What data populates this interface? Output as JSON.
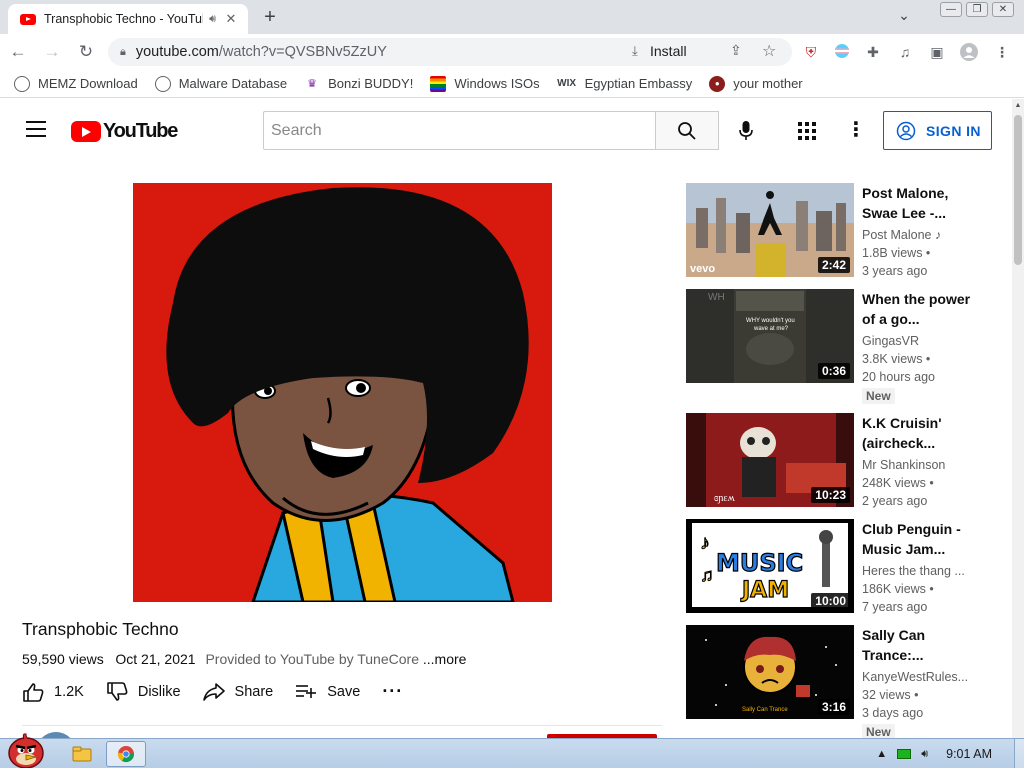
{
  "browser": {
    "tab": {
      "title": "Transphobic Techno - YouTube",
      "audio_icon": "speaker-icon",
      "close": "✕"
    },
    "new_tab": "+",
    "url_host": "youtube.com",
    "url_path": "/watch?v=QVSBNv5ZzUY",
    "install_label": "Install",
    "extension_badge": "14",
    "window_buttons": [
      "—",
      "❐",
      "✕"
    ]
  },
  "bookmarks": [
    {
      "label": "MEMZ Download",
      "icon": "globe-icon"
    },
    {
      "label": "Malware Database",
      "icon": "globe-icon"
    },
    {
      "label": "Bonzi BUDDY!",
      "icon": "bonzi-icon"
    },
    {
      "label": "Windows ISOs",
      "icon": "rainbow-flag-icon"
    },
    {
      "label": "Egyptian Embassy",
      "icon": "wix-icon",
      "icon_text": "WIX"
    },
    {
      "label": "your mother",
      "icon": "avatar-icon"
    }
  ],
  "youtube": {
    "logo": "YouTube",
    "search_placeholder": "Search",
    "signin_label": "SIGN IN",
    "video": {
      "title": "Transphobic Techno",
      "views": "59,590 views",
      "date": "Oct 21, 2021",
      "provided": "Provided to YouTube by TuneCore",
      "more": "...more",
      "likes": "1.2K",
      "dislike_label": "Dislike",
      "share_label": "Share",
      "save_label": "Save"
    },
    "related": [
      {
        "title": "Post Malone, Swae Lee -...",
        "channel": "Post Malone ♪",
        "views": "1.8B views •",
        "age": "3 years ago",
        "duration": "2:42",
        "badge": ""
      },
      {
        "title": "When the power of a go...",
        "channel": "GingasVR",
        "views": "3.8K views •",
        "age": "20 hours ago",
        "duration": "0:36",
        "badge": "New"
      },
      {
        "title": "K.K Cruisin' (aircheck...",
        "channel": "Mr Shankinson",
        "views": "248K views •",
        "age": "2 years ago",
        "duration": "10:23",
        "badge": ""
      },
      {
        "title": "Club Penguin - Music Jam...",
        "channel": "Heres the thang ...",
        "views": "186K views •",
        "age": "7 years ago",
        "duration": "10:00",
        "badge": ""
      },
      {
        "title": "Sally Can Trance:...",
        "channel": "KanyeWestRules...",
        "views": "32 views •",
        "age": "3 days ago",
        "duration": "3:16",
        "badge": "New"
      }
    ]
  },
  "taskbar": {
    "time": "9:01 AM"
  },
  "colors": {
    "youtube_red": "#ff0000",
    "link_blue": "#065fd4",
    "player_bg": "#d71a0d"
  }
}
